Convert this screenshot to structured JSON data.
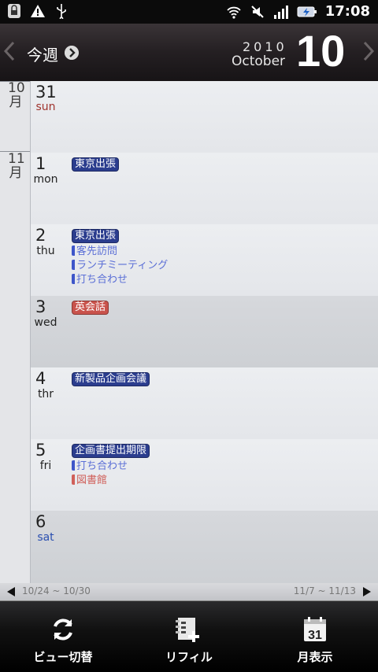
{
  "status_bar": {
    "time": "17:08"
  },
  "header": {
    "week_label": "今週",
    "year": "2010",
    "month_name": "October",
    "day": "10"
  },
  "months": [
    {
      "label_num": "10",
      "label_kanji": "月"
    },
    {
      "label_num": "11",
      "label_kanji": "月"
    }
  ],
  "days": [
    {
      "num": "31",
      "name": "sun",
      "events": []
    },
    {
      "num": "1",
      "name": "mon",
      "events": [
        {
          "text": "東京出張",
          "style": "badge",
          "color": "blue"
        }
      ]
    },
    {
      "num": "2",
      "name": "thu",
      "events": [
        {
          "text": "東京出張",
          "style": "badge",
          "color": "blue"
        },
        {
          "text": "客先訪問",
          "style": "line",
          "color": "blue"
        },
        {
          "text": "ランチミーティング",
          "style": "line",
          "color": "blue"
        },
        {
          "text": "打ち合わせ",
          "style": "line",
          "color": "blue"
        }
      ]
    },
    {
      "num": "3",
      "name": "wed",
      "events": [
        {
          "text": "英会話",
          "style": "badge",
          "color": "red"
        }
      ]
    },
    {
      "num": "4",
      "name": "thr",
      "events": [
        {
          "text": "新製品企画会議",
          "style": "badge",
          "color": "blue"
        }
      ]
    },
    {
      "num": "5",
      "name": "fri",
      "events": [
        {
          "text": "企画書提出期限",
          "style": "badge",
          "color": "blue"
        },
        {
          "text": "打ち合わせ",
          "style": "line",
          "color": "blue"
        },
        {
          "text": "図書館",
          "style": "line",
          "color": "red"
        }
      ]
    },
    {
      "num": "6",
      "name": "sat",
      "events": []
    }
  ],
  "week_nav": {
    "prev": "10/24 ~ 10/30",
    "next": "11/7 ~ 11/13"
  },
  "toolbar": {
    "view_switch": "ビュー切替",
    "refill": "リフィル",
    "month_view": "月表示",
    "calendar_icon_day": "31"
  },
  "colors": {
    "event_blue": "#2b3d8e",
    "event_red": "#c9534c",
    "sun": "#a0342e",
    "sat": "#2a4fb0"
  }
}
